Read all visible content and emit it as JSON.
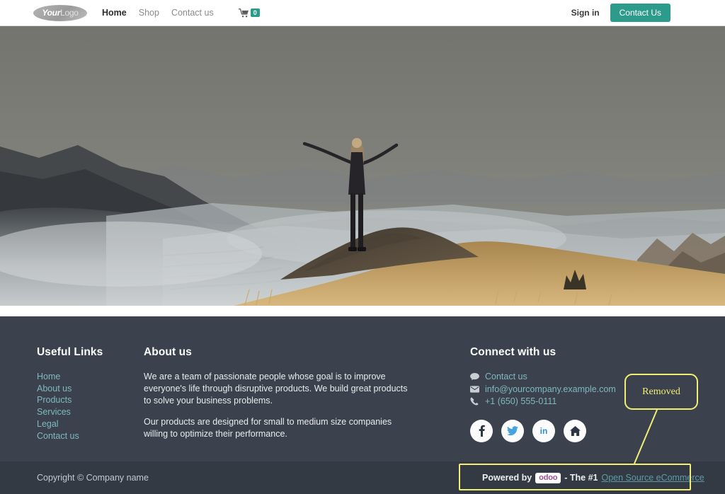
{
  "header": {
    "logo": {
      "part1": "Your",
      "part2": "Logo",
      "name": "your-logo"
    },
    "nav": [
      {
        "label": "Home",
        "active": true
      },
      {
        "label": "Shop",
        "active": false
      },
      {
        "label": "Contact us",
        "active": false
      }
    ],
    "cart": {
      "icon": "shopping-cart-icon",
      "count": "0"
    },
    "sign_in": "Sign in",
    "contact_button": "Contact Us"
  },
  "hero": {
    "alt": "woman standing on mountain ridge with arms raised above misty valley",
    "colors": {
      "sky": "#7d7d79",
      "mist": "#9aa0a2",
      "grass": "#c3a06b",
      "rock": "#584c3d"
    }
  },
  "footer": {
    "useful_links": {
      "title": "Useful Links",
      "items": [
        "Home",
        "About us",
        "Products",
        "Services",
        "Legal",
        "Contact us"
      ]
    },
    "about": {
      "title": "About us",
      "paragraphs": [
        "We are a team of passionate people whose goal is to improve everyone's life through disruptive products. We build great products to solve your business problems.",
        "Our products are designed for small to medium size companies willing to optimize their performance."
      ]
    },
    "connect": {
      "title": "Connect with us",
      "contacts": [
        {
          "icon": "chat-bubble-icon",
          "label": "Contact us"
        },
        {
          "icon": "envelope-icon",
          "label": "info@yourcompany.example.com"
        },
        {
          "icon": "phone-icon",
          "label": "+1 (650) 555-0111"
        }
      ],
      "socials": [
        {
          "icon": "facebook-icon",
          "label": "f"
        },
        {
          "icon": "twitter-icon",
          "label": ""
        },
        {
          "icon": "linkedin-icon",
          "label": "in"
        },
        {
          "icon": "home-icon",
          "label": ""
        }
      ]
    }
  },
  "copyright_bar": {
    "copyright": "Copyright © Company name",
    "powered_prefix": "Powered by",
    "odoo_logo": "odoo",
    "powered_middle": "- The #1",
    "powered_link": "Open Source eCommerce"
  },
  "annotations": {
    "callout_label": "Removed",
    "highlight_color": "#f2ee73"
  },
  "colors": {
    "accent_teal": "#2d9b8b",
    "footer_bg": "#3b424d",
    "copybar_bg": "#333a44",
    "footer_link": "#7fb8bd",
    "annotation": "#f2ee73"
  }
}
